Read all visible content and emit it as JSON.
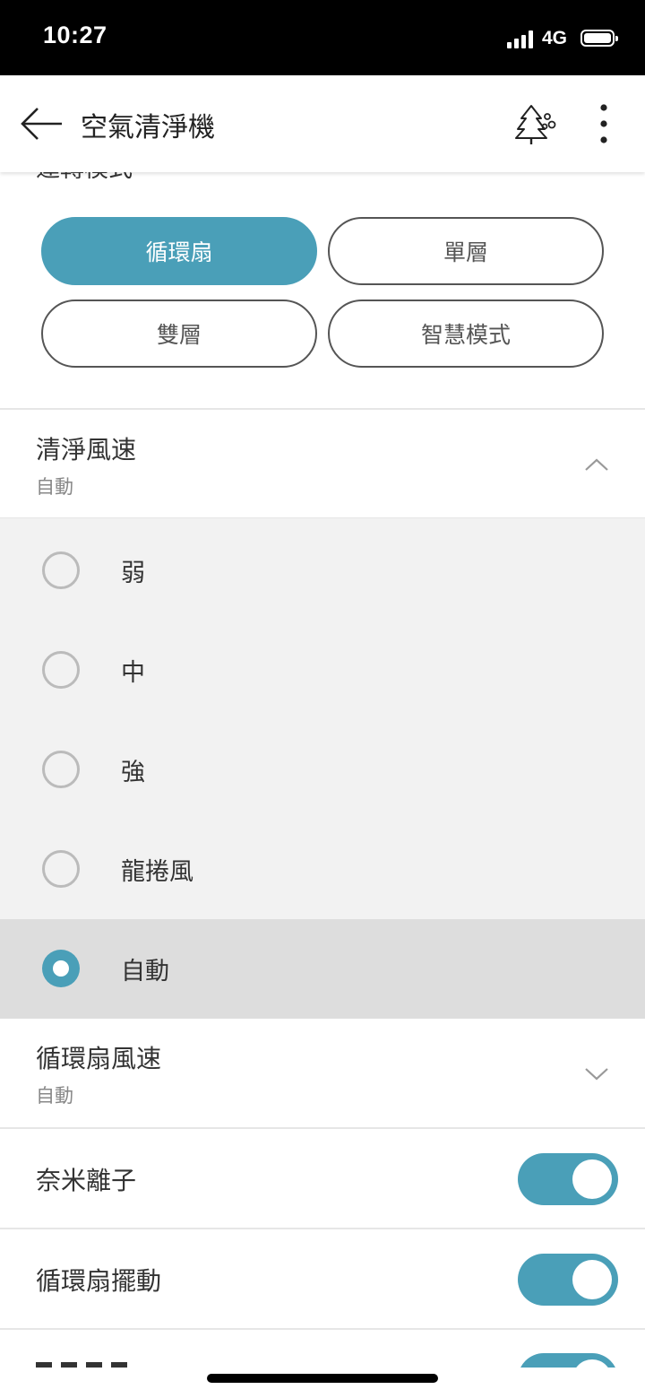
{
  "status_bar": {
    "time": "10:27",
    "network": "4G"
  },
  "header": {
    "title": "空氣清淨機"
  },
  "run_mode": {
    "section_title": "運轉模式",
    "buttons": [
      {
        "label": "循環扇",
        "selected": true
      },
      {
        "label": "單層",
        "selected": false
      },
      {
        "label": "雙層",
        "selected": false
      },
      {
        "label": "智慧模式",
        "selected": false
      }
    ]
  },
  "clean_speed": {
    "title": "清淨風速",
    "value": "自動",
    "expanded": true,
    "options": [
      {
        "label": "弱",
        "selected": false
      },
      {
        "label": "中",
        "selected": false
      },
      {
        "label": "強",
        "selected": false
      },
      {
        "label": "龍捲風",
        "selected": false
      },
      {
        "label": "自動",
        "selected": true
      }
    ]
  },
  "fan_speed": {
    "title": "循環扇風速",
    "value": "自動"
  },
  "toggles": [
    {
      "label": "奈米離子",
      "on": true
    },
    {
      "label": "循環扇擺動",
      "on": true
    }
  ],
  "colors": {
    "accent": "#4a9fb8",
    "selected_row": "#dddddd",
    "options_bg": "#f2f2f2"
  }
}
